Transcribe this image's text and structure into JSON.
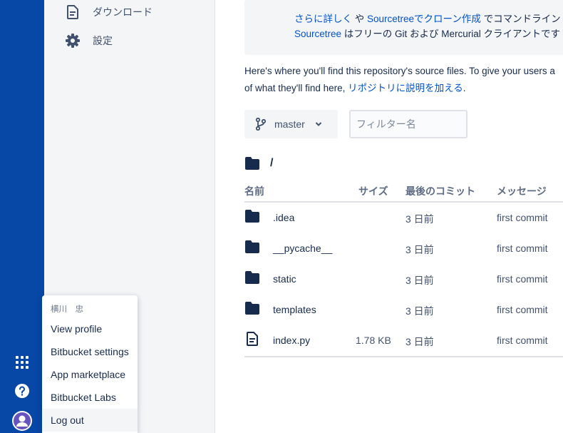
{
  "sidebar": {
    "items": [
      {
        "label": "ダウンロード",
        "icon": "document-icon"
      },
      {
        "label": "設定",
        "icon": "gear-icon"
      }
    ]
  },
  "global_nav": {
    "icons": [
      "app-switcher-icon",
      "help-icon",
      "avatar"
    ]
  },
  "info_box": {
    "line1": {
      "link1": "さらに詳しく",
      "text1": " や ",
      "link2": "Sourcetreeでクローン作成",
      "text2": " でコマンドライン"
    },
    "line2": {
      "link1": "Sourcetree",
      "text1": " はフリーの Git および Mercurial クライアントです"
    }
  },
  "description": {
    "line1": "Here's where you'll find this repository's source files. To give your users a",
    "line2_text": "of what they'll find here, ",
    "line2_link": "リポジトリに説明を加える",
    "line2_end": "."
  },
  "branch": {
    "label": "master"
  },
  "filter": {
    "placeholder": "フィルター名"
  },
  "path": {
    "text": "/"
  },
  "table": {
    "headers": {
      "name": "名前",
      "size": "サイズ",
      "commit": "最後のコミット",
      "message": "メッセージ"
    },
    "rows": [
      {
        "type": "folder",
        "name": ".idea",
        "size": "",
        "commit": "3 日前",
        "message": "first commit"
      },
      {
        "type": "folder",
        "name": "__pycache__",
        "size": "",
        "commit": "3 日前",
        "message": "first commit"
      },
      {
        "type": "folder",
        "name": "static",
        "size": "",
        "commit": "3 日前",
        "message": "first commit"
      },
      {
        "type": "folder",
        "name": "templates",
        "size": "",
        "commit": "3 日前",
        "message": "first commit"
      },
      {
        "type": "file",
        "name": "index.py",
        "size": "1.78 KB",
        "commit": "3 日前",
        "message": "first commit"
      }
    ]
  },
  "profile_menu": {
    "username": "横川　忠",
    "items": [
      "View profile",
      "Bitbucket settings",
      "App marketplace",
      "Bitbucket Labs",
      "Log out"
    ]
  },
  "colors": {
    "nav": "#0747A6",
    "link": "#0052CC",
    "text": "#172B4D",
    "sidebar_bg": "#F4F5F7"
  }
}
